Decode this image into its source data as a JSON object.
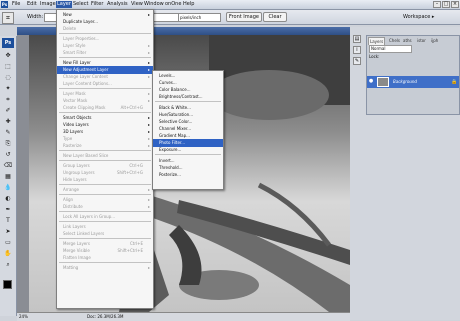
{
  "menubar": {
    "app_icon": "Ps",
    "items": [
      "File",
      "Edit",
      "Image",
      "Layer",
      "Select",
      "Filter",
      "Analysis",
      "View",
      "Window",
      "onOne",
      "Help"
    ],
    "active": "Layer"
  },
  "options": {
    "width_label": "Width:",
    "resolution_unit": "pixels/inch",
    "front_image_label": "Front Image",
    "clear_label": "Clear",
    "workspace_label": "Workspace ▸"
  },
  "toolbox": {
    "badge": "Ps",
    "icons": [
      "move-icon",
      "marquee-icon",
      "lasso-icon",
      "magic-wand-icon",
      "crop-icon",
      "eyedropper-icon",
      "healing-icon",
      "brush-icon",
      "clone-stamp-icon",
      "history-brush-icon",
      "eraser-icon",
      "gradient-icon",
      "blur-icon",
      "dodge-icon",
      "pen-icon",
      "type-icon",
      "path-select-icon",
      "shape-icon",
      "hand-icon",
      "zoom-icon"
    ]
  },
  "status": {
    "zoom": "24%",
    "doc_info": "Doc: 26.3M/26.3M"
  },
  "layer_menu": {
    "items": [
      {
        "label": "New",
        "arrow": true,
        "disabled": false
      },
      {
        "label": "Duplicate Layer...",
        "disabled": false
      },
      {
        "label": "Delete",
        "disabled": true
      },
      {
        "sep": true
      },
      {
        "label": "Layer Properties...",
        "disabled": true
      },
      {
        "label": "Layer Style",
        "arrow": true,
        "disabled": true
      },
      {
        "label": "Smart Filter",
        "arrow": true,
        "disabled": true
      },
      {
        "sep": true
      },
      {
        "label": "New Fill Layer",
        "arrow": true,
        "disabled": false
      },
      {
        "label": "New Adjustment Layer",
        "arrow": true,
        "disabled": false,
        "highlight": true
      },
      {
        "label": "Change Layer Content",
        "arrow": true,
        "disabled": true
      },
      {
        "label": "Layer Content Options...",
        "disabled": true
      },
      {
        "sep": true
      },
      {
        "label": "Layer Mask",
        "arrow": true,
        "disabled": true
      },
      {
        "label": "Vector Mask",
        "arrow": true,
        "disabled": true
      },
      {
        "label": "Create Clipping Mask",
        "shortcut": "Alt+Ctrl+G",
        "disabled": true
      },
      {
        "sep": true
      },
      {
        "label": "Smart Objects",
        "arrow": true,
        "disabled": false
      },
      {
        "label": "Video Layers",
        "arrow": true,
        "disabled": false
      },
      {
        "label": "3D Layers",
        "arrow": true,
        "disabled": false
      },
      {
        "label": "Type",
        "arrow": true,
        "disabled": true
      },
      {
        "label": "Rasterize",
        "arrow": true,
        "disabled": true
      },
      {
        "sep": true
      },
      {
        "label": "New Layer Based Slice",
        "disabled": true
      },
      {
        "sep": true
      },
      {
        "label": "Group Layers",
        "shortcut": "Ctrl+G",
        "disabled": true
      },
      {
        "label": "Ungroup Layers",
        "shortcut": "Shift+Ctrl+G",
        "disabled": true
      },
      {
        "label": "Hide Layers",
        "disabled": true
      },
      {
        "sep": true
      },
      {
        "label": "Arrange",
        "arrow": true,
        "disabled": true
      },
      {
        "sep": true
      },
      {
        "label": "Align",
        "arrow": true,
        "disabled": true
      },
      {
        "label": "Distribute",
        "arrow": true,
        "disabled": true
      },
      {
        "sep": true
      },
      {
        "label": "Lock All Layers in Group...",
        "disabled": true
      },
      {
        "sep": true
      },
      {
        "label": "Link Layers",
        "disabled": true
      },
      {
        "label": "Select Linked Layers",
        "disabled": true
      },
      {
        "sep": true
      },
      {
        "label": "Merge Layers",
        "shortcut": "Ctrl+E",
        "disabled": true
      },
      {
        "label": "Merge Visible",
        "shortcut": "Shift+Ctrl+E",
        "disabled": true
      },
      {
        "label": "Flatten Image",
        "disabled": true
      },
      {
        "sep": true
      },
      {
        "label": "Matting",
        "arrow": true,
        "disabled": true
      }
    ]
  },
  "adjustment_submenu": {
    "items": [
      {
        "label": "Levels..."
      },
      {
        "label": "Curves..."
      },
      {
        "label": "Color Balance..."
      },
      {
        "label": "Brightness/Contrast..."
      },
      {
        "sep": true
      },
      {
        "label": "Black & White..."
      },
      {
        "label": "Hue/Saturation..."
      },
      {
        "label": "Selective Color..."
      },
      {
        "label": "Channel Mixer..."
      },
      {
        "label": "Gradient Map..."
      },
      {
        "label": "Photo Filter...",
        "highlight": true
      },
      {
        "label": "Exposure..."
      },
      {
        "sep": true
      },
      {
        "label": "Invert..."
      },
      {
        "label": "Threshold..."
      },
      {
        "label": "Posterize..."
      }
    ]
  },
  "layers_panel": {
    "tabs": [
      "Layers",
      "Chels",
      "aths",
      "istor",
      "ijph"
    ],
    "blend_mode": "Normal",
    "lock_label": "Lock:",
    "layer_name": "Background"
  },
  "colors": {
    "menu_highlight": "#2f62c4",
    "menubar_active": "#2d5aa8",
    "layer_selected": "#3f6fc8"
  }
}
